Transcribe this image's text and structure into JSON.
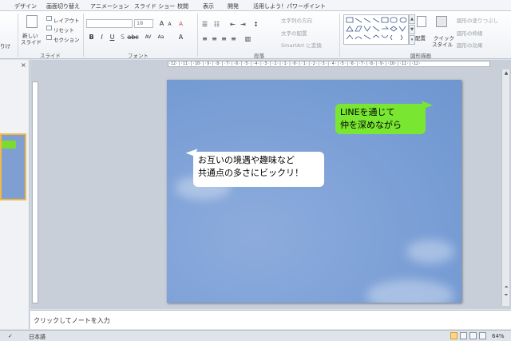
{
  "tabs": [
    "デザイン",
    "画面切り替え",
    "アニメーション",
    "スライド ショー",
    "校閲",
    "表示",
    "開発",
    "活用しよう！パワーポイント"
  ],
  "ribbon": {
    "clipboard_partial": "りけ",
    "new_slide": [
      "新しい",
      "スライド"
    ],
    "layout": "レイアウト",
    "reset": "リセット",
    "section": "セクション",
    "slides_group": "スライド",
    "font_size": "18",
    "font_group": "フォント",
    "text_direction": "文字列の方向",
    "align_text": "文字の配置",
    "smartart": "SmartArt に変換",
    "paragraph_group": "段落",
    "arrange": "配置",
    "quick_styles": [
      "クイック",
      "スタイル"
    ],
    "shape_fill": "図形の塗りつぶし",
    "shape_outline": "図形の枠線",
    "shape_effects": "図形の効果",
    "drawing_group": "図形描画"
  },
  "thumbs": {
    "close": "×"
  },
  "ruler": {
    "h_ticks": "·12·|·11·|·10·|·9·|·8·|·7·|·6·|·5·|·4·|·3·|·2·|·1·|·0·|·1·|·2·|·3·|·4·|·5·|·6·|·7·|·8·|·9·|·10·|·11·|·12·"
  },
  "slide": {
    "green_bubble": [
      "LINEを通じて",
      "仲を深めながら"
    ],
    "white_bubble": [
      "お互いの境遇や趣味など",
      "共通点の多さにビックリ！"
    ]
  },
  "notes": {
    "placeholder": "クリックしてノートを入力"
  },
  "status": {
    "language": "日本語",
    "zoom": "64%"
  },
  "colors": {
    "green_bubble": "#79e631",
    "slide_bg": "#7b9fd6",
    "selected_thumb_border": "#f2b845"
  }
}
